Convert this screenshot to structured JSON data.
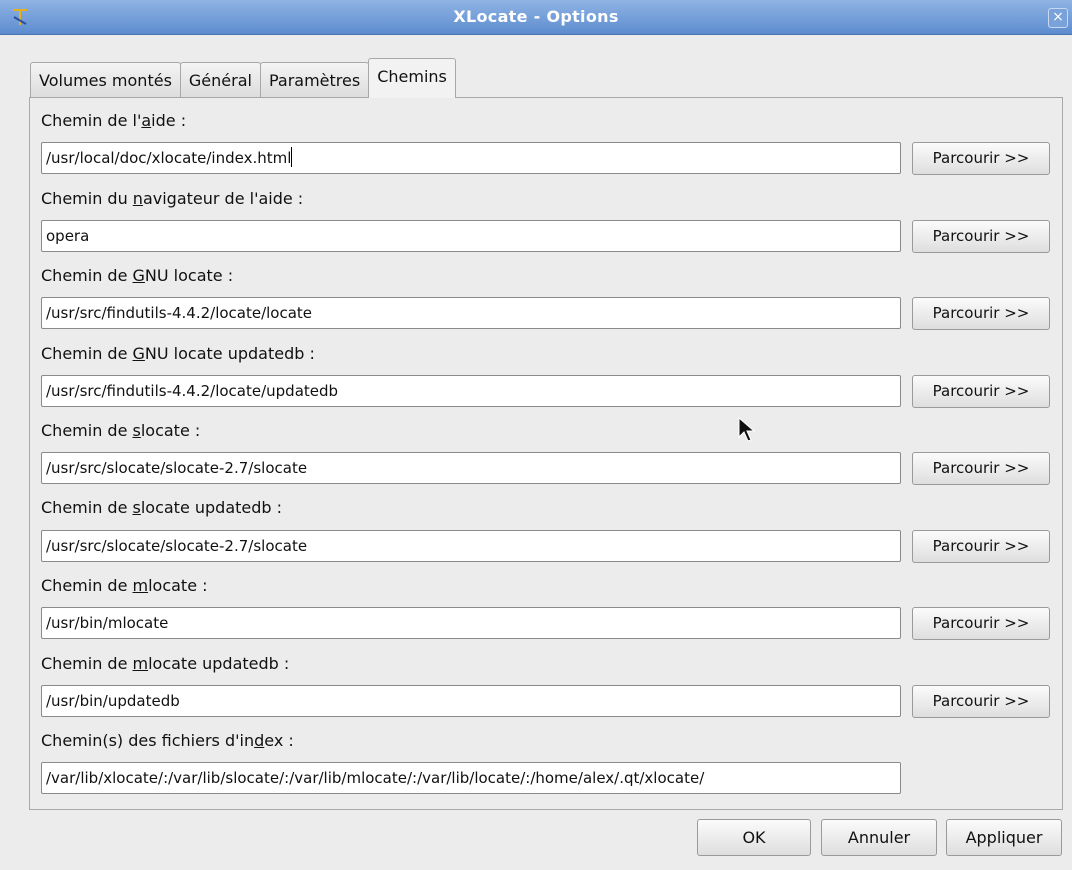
{
  "window": {
    "title": "XLocate - Options"
  },
  "tabs": [
    "Volumes montés",
    "Général",
    "Paramètres",
    "Chemins"
  ],
  "active_tab": "Chemins",
  "paths": [
    {
      "label_pre": "Chemin de l'",
      "label_key": "a",
      "label_post": "ide :",
      "value": "/usr/local/doc/xlocate/index.html",
      "browse": "Parcourir >>"
    },
    {
      "label_pre": "Chemin du ",
      "label_key": "n",
      "label_post": "avigateur de l'aide :",
      "value": "opera",
      "browse": "Parcourir >>"
    },
    {
      "label_pre": "Chemin de ",
      "label_key": "G",
      "label_post": "NU locate :",
      "value": "/usr/src/findutils-4.4.2/locate/locate",
      "browse": "Parcourir >>"
    },
    {
      "label_pre": "Chemin de ",
      "label_key": "G",
      "label_post": "NU locate updatedb :",
      "value": "/usr/src/findutils-4.4.2/locate/updatedb",
      "browse": "Parcourir >>"
    },
    {
      "label_pre": "Chemin de ",
      "label_key": "s",
      "label_post": "locate :",
      "value": "/usr/src/slocate/slocate-2.7/slocate",
      "browse": "Parcourir >>"
    },
    {
      "label_pre": "Chemin de ",
      "label_key": "s",
      "label_post": "locate updatedb :",
      "value": "/usr/src/slocate/slocate-2.7/slocate",
      "browse": "Parcourir >>"
    },
    {
      "label_pre": "Chemin de ",
      "label_key": "m",
      "label_post": "locate :",
      "value": "/usr/bin/mlocate",
      "browse": "Parcourir >>"
    },
    {
      "label_pre": "Chemin de ",
      "label_key": "m",
      "label_post": "locate updatedb :",
      "value": "/usr/bin/updatedb",
      "browse": "Parcourir >>"
    }
  ],
  "index_files": {
    "label_pre": "Chemin(s) des fichiers d'in",
    "label_key": "d",
    "label_post": "ex :",
    "value": "/var/lib/xlocate/:/var/lib/slocate/:/var/lib/mlocate/:/var/lib/locate/:/home/alex/.qt/xlocate/"
  },
  "buttons": {
    "ok": "OK",
    "cancel": "Annuler",
    "apply": "Appliquer"
  },
  "colors": {
    "titlebar": "#6b97d6",
    "title_text": "#ffffff",
    "background": "#ececec"
  }
}
